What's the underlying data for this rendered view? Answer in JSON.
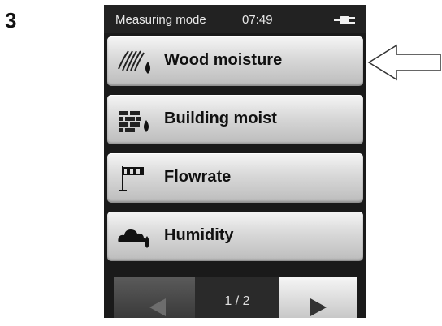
{
  "figure": {
    "step_number": "3"
  },
  "statusbar": {
    "title": "Measuring mode",
    "time": "07:49",
    "power_icon": "plug-icon"
  },
  "menu": {
    "items": [
      {
        "label": "Wood moisture",
        "icon": "wood-grain-drop-icon"
      },
      {
        "label": "Building moist",
        "icon": "brick-wall-drop-icon"
      },
      {
        "label": "Flowrate",
        "icon": "windsock-icon"
      },
      {
        "label": "Humidity",
        "icon": "cloud-drop-icon"
      }
    ]
  },
  "pager": {
    "indicator": "1 / 2",
    "prev_icon": "arrow-left-icon",
    "next_icon": "arrow-right-icon"
  },
  "annotation": {
    "pointer": "callout-arrow-icon"
  }
}
